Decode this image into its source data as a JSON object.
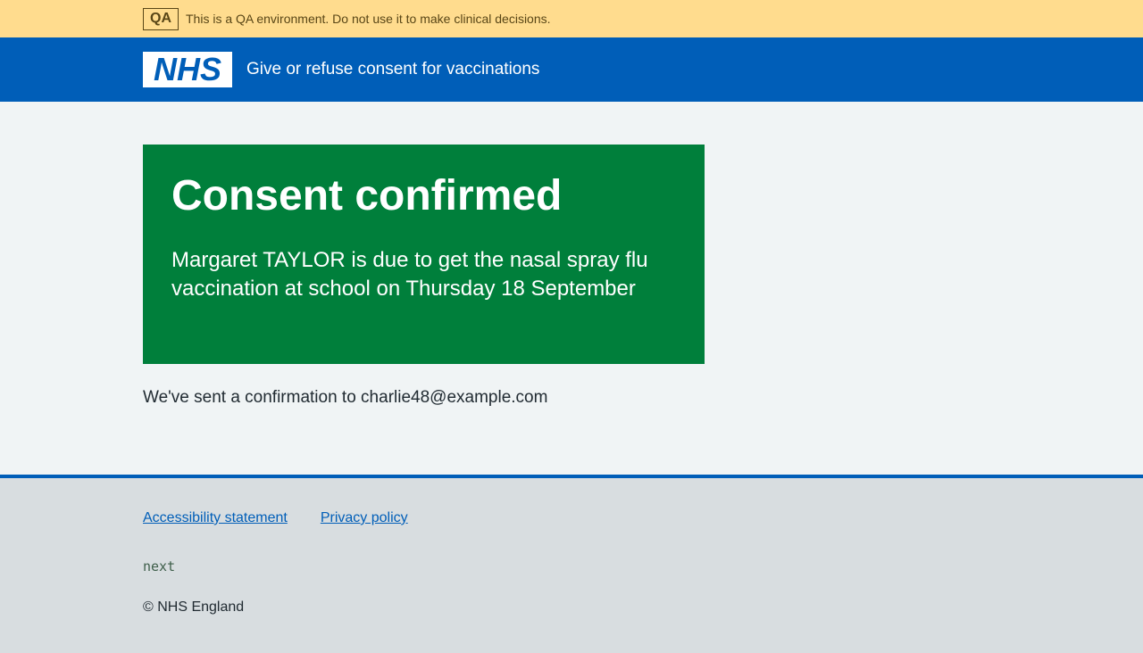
{
  "qa_banner": {
    "tag": "QA",
    "message": "This is a QA environment. Do not use it to make clinical decisions."
  },
  "header": {
    "logo_text": "NHS",
    "service_name": "Give or refuse consent for vaccinations"
  },
  "panel": {
    "title": "Consent confirmed",
    "body": "Margaret TAYLOR is due to get the nasal spray flu vaccination at school on Thursday 18 September"
  },
  "confirmation_text": "We've sent a confirmation to charlie48@example.com",
  "footer": {
    "links": [
      {
        "label": "Accessibility statement"
      },
      {
        "label": "Privacy policy"
      }
    ],
    "version": "next",
    "copyright": "© NHS England"
  },
  "colors": {
    "qa_banner": "#ffdc8e",
    "nhs_blue": "#005eb8",
    "success_green": "#007f3b",
    "page_background": "#f0f4f5",
    "footer_background": "#d8dde0"
  }
}
